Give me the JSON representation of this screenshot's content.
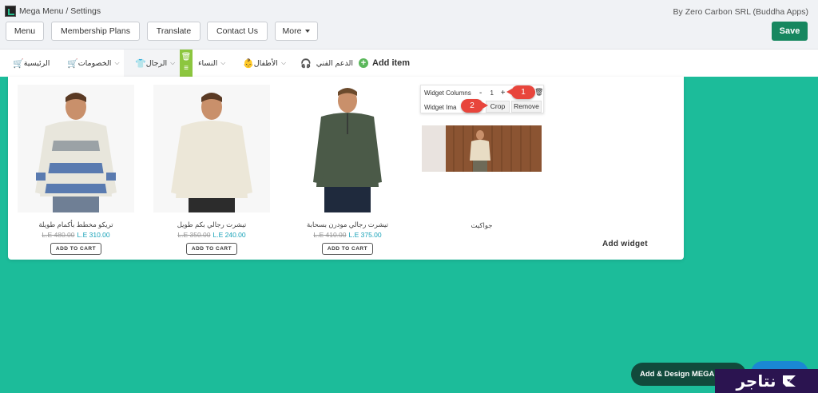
{
  "app": {
    "title": "Mega Menu / Settings",
    "vendor": "By Zero Carbon SRL (Buddha Apps)"
  },
  "toolbar": {
    "buttons": [
      "Menu",
      "Membership Plans",
      "Translate",
      "Contact Us",
      "More"
    ],
    "save_label": "Save"
  },
  "menu": {
    "items": [
      {
        "label": "الرئيسية",
        "icon": "cart-icon"
      },
      {
        "label": "الخصومات",
        "icon": "cart-icon"
      },
      {
        "label": "الرجال",
        "icon": "shirt-icon"
      },
      {
        "label": "النساء",
        "icon": "dress-icon"
      },
      {
        "label": "الأطفال",
        "icon": "child-icon"
      },
      {
        "label": "الدعم الفني",
        "icon": "headset-icon"
      }
    ],
    "add_item_label": "Add item"
  },
  "products": [
    {
      "name": "تريكو مخطط بأكمام طويلة",
      "old_price": "L.E 480.00",
      "new_price": "L.E 310.00",
      "cart": "ADD TO CART"
    },
    {
      "name": "تيشرت رجالي بكم طويل",
      "old_price": "L.E 350.00",
      "new_price": "L.E 240.00",
      "cart": "ADD TO CART"
    },
    {
      "name": "تيشرت رجالي مودرن بسحابة",
      "old_price": "L.E 410.00",
      "new_price": "L.E 375.00",
      "cart": "ADD TO CART"
    }
  ],
  "widget_tools": {
    "columns_label": "Widget Columns",
    "minus": "-",
    "value": "1",
    "plus": "+",
    "image_label": "Widget Ima",
    "crop_label": "Crop",
    "remove_label": "Remove"
  },
  "markers": [
    "1",
    "2"
  ],
  "jacket_caption": "جواكيت",
  "add_widget_label": "Add widget",
  "cta_label": "Add & Design MEGA MENU",
  "brand_label": "نتاجر",
  "colors": {
    "page_bg": "#1cbc9a",
    "save": "#16875f",
    "price": "#17a2b8",
    "marker": "#e8453c",
    "brand": "#2b1450"
  }
}
